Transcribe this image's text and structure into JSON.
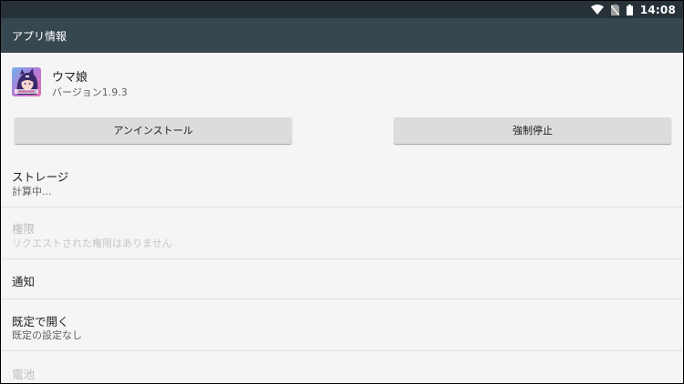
{
  "status_bar": {
    "time": "14:08",
    "icons": [
      "wifi-icon",
      "no-sim-icon",
      "battery-icon"
    ],
    "background": "#263238"
  },
  "app_bar": {
    "title": "アプリ情報",
    "background": "#37474f"
  },
  "app": {
    "name": "ウマ娘",
    "version": "バージョン1.9.3",
    "icon": "app-icon"
  },
  "buttons": {
    "uninstall": "アンインストール",
    "force_stop": "強制停止"
  },
  "sections": [
    {
      "title": "ストレージ",
      "subtitle": "計算中...",
      "enabled": true
    },
    {
      "title": "権限",
      "subtitle": "リクエストされた権限はありません",
      "enabled": false
    },
    {
      "title": "通知",
      "subtitle": "",
      "enabled": true
    },
    {
      "title": "既定で開く",
      "subtitle": "既定の設定なし",
      "enabled": true
    },
    {
      "title": "電池",
      "subtitle": "",
      "enabled": false
    }
  ]
}
